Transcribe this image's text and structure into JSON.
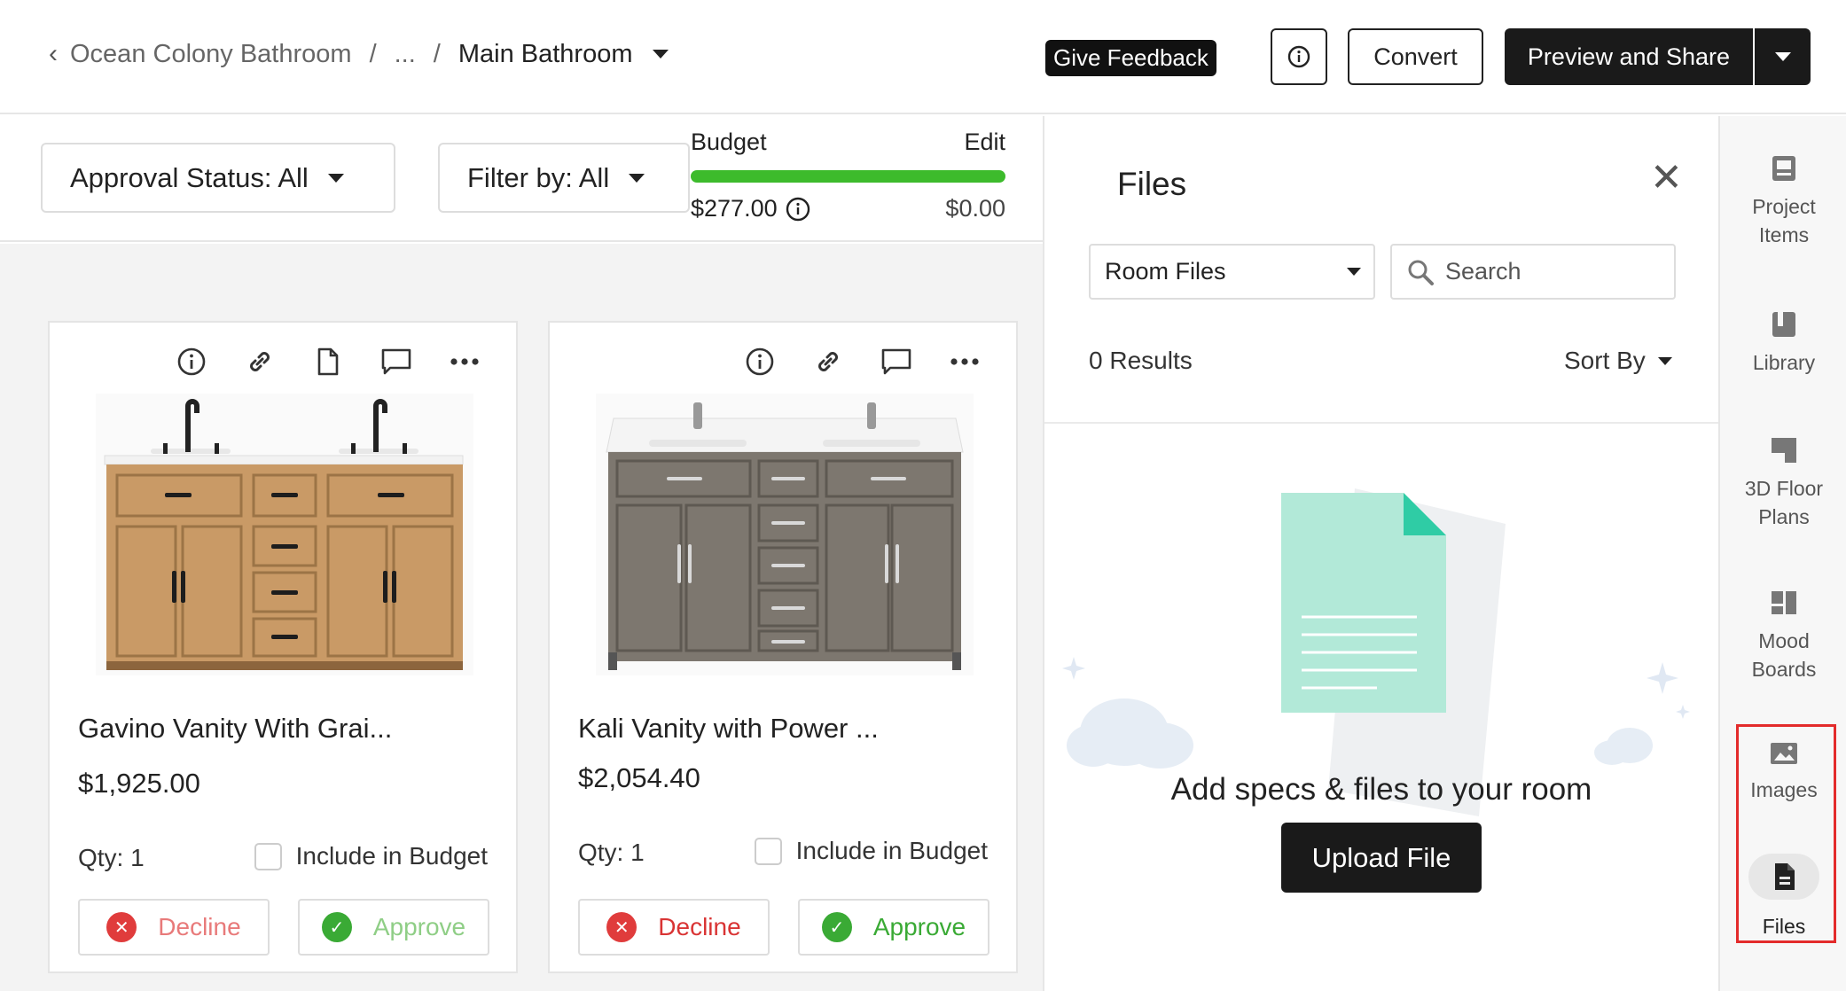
{
  "header": {
    "breadcrumb_root": "Ocean Colony Bathroom",
    "breadcrumb_sep1": "/",
    "breadcrumb_ellipsis": "...",
    "breadcrumb_sep2": "/",
    "breadcrumb_current": "Main Bathroom",
    "feedback_label": "Give Feedback",
    "convert_label": "Convert",
    "preview_label": "Preview and Share"
  },
  "filters": {
    "approval_status": "Approval Status: All",
    "filter_by": "Filter by: All"
  },
  "budget": {
    "label": "Budget",
    "edit_label": "Edit",
    "spent": "$277.00",
    "remaining": "$0.00",
    "progress_fraction": 1.0,
    "bar_color": "#3dbb2c"
  },
  "products": [
    {
      "title": "Gavino Vanity With Grai...",
      "price": "$1,925.00",
      "qty": "Qty: 1",
      "include_label": "Include in Budget",
      "decline_label": "Decline",
      "approve_label": "Approve"
    },
    {
      "title": "Kali Vanity with Power ...",
      "price": "$2,054.40",
      "qty": "Qty: 1",
      "include_label": "Include in Budget",
      "decline_label": "Decline",
      "approve_label": "Approve"
    }
  ],
  "files_panel": {
    "title": "Files",
    "room_select": "Room Files",
    "search_placeholder": "Search",
    "results": "0 Results",
    "sort_label": "Sort By",
    "empty_message": "Add specs & files to your room",
    "upload_label": "Upload File"
  },
  "rail": {
    "project_items_l1": "Project",
    "project_items_l2": "Items",
    "library": "Library",
    "floor_plans_l1": "3D Floor",
    "floor_plans_l2": "Plans",
    "mood_boards_l1": "Mood",
    "mood_boards_l2": "Boards",
    "images": "Images",
    "files": "Files"
  },
  "colors": {
    "decline": "#e03c3c",
    "approve": "#3aaa35",
    "highlight": "#e32b2b",
    "dark_button": "#1a1a1a"
  }
}
